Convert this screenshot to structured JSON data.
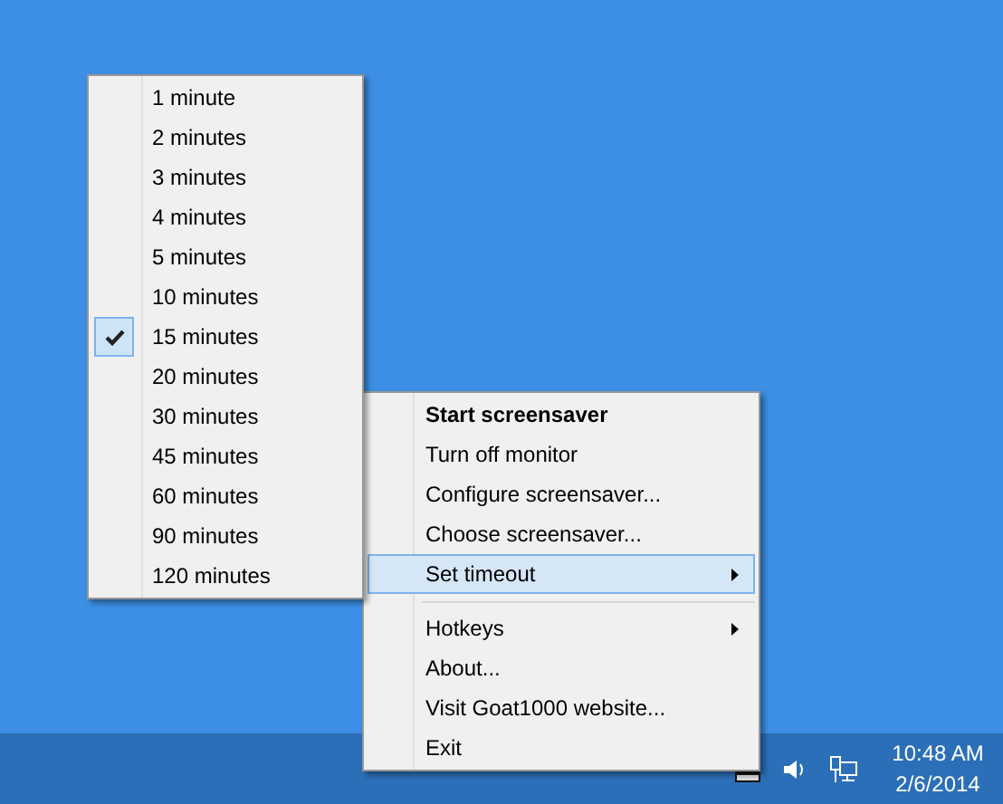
{
  "context_menu": {
    "items": [
      {
        "kind": "command",
        "label": "Start screensaver",
        "default": true,
        "selected": false
      },
      {
        "kind": "command",
        "label": "Turn off monitor",
        "default": false,
        "selected": false
      },
      {
        "kind": "command",
        "label": "Configure screensaver...",
        "default": false,
        "selected": false
      },
      {
        "kind": "command",
        "label": "Choose screensaver...",
        "default": false,
        "selected": false
      },
      {
        "kind": "submenu",
        "label": "Set timeout",
        "default": false,
        "selected": true
      },
      {
        "kind": "separator"
      },
      {
        "kind": "submenu",
        "label": "Hotkeys",
        "default": false,
        "selected": false
      },
      {
        "kind": "command",
        "label": "About...",
        "default": false,
        "selected": false
      },
      {
        "kind": "command",
        "label": "Visit Goat1000 website...",
        "default": false,
        "selected": false
      },
      {
        "kind": "command",
        "label": "Exit",
        "default": false,
        "selected": false
      }
    ]
  },
  "timeout_submenu": {
    "items": [
      {
        "label": "1 minute",
        "checked": false
      },
      {
        "label": "2 minutes",
        "checked": false
      },
      {
        "label": "3 minutes",
        "checked": false
      },
      {
        "label": "4 minutes",
        "checked": false
      },
      {
        "label": "5 minutes",
        "checked": false
      },
      {
        "label": "10 minutes",
        "checked": false
      },
      {
        "label": "15 minutes",
        "checked": true
      },
      {
        "label": "20 minutes",
        "checked": false
      },
      {
        "label": "30 minutes",
        "checked": false
      },
      {
        "label": "45 minutes",
        "checked": false
      },
      {
        "label": "60 minutes",
        "checked": false
      },
      {
        "label": "90 minutes",
        "checked": false
      },
      {
        "label": "120 minutes",
        "checked": false
      }
    ]
  },
  "taskbar": {
    "clock": {
      "time": "10:48 AM",
      "date": "2/6/2014"
    }
  }
}
